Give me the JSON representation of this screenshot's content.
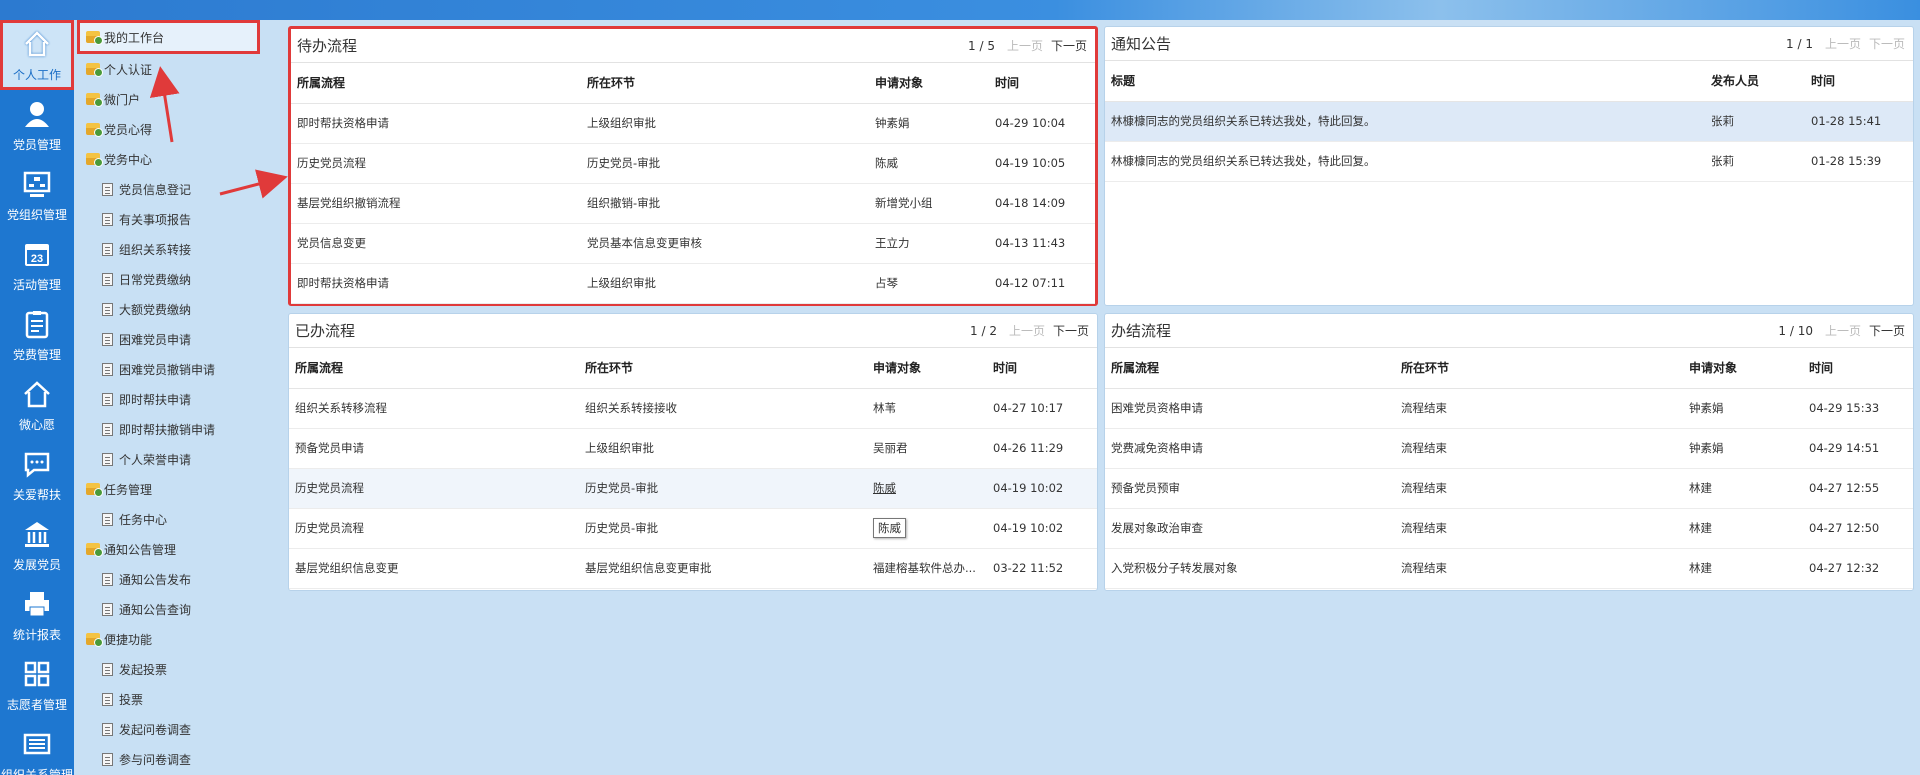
{
  "colors": {
    "accent": "#1e77d0",
    "highlight_border": "#e03a3a",
    "panel_bg": "#ffffff",
    "page_bg": "#c9e0f4"
  },
  "nav": [
    {
      "label": "个人工作",
      "icon": "home-icon"
    },
    {
      "label": "党员管理",
      "icon": "user-icon"
    },
    {
      "label": "党组织管理",
      "icon": "org-chart-icon"
    },
    {
      "label": "活动管理",
      "icon": "calendar-icon"
    },
    {
      "label": "党费管理",
      "icon": "clipboard-icon"
    },
    {
      "label": "微心愿",
      "icon": "home-outline-icon"
    },
    {
      "label": "关爱帮扶",
      "icon": "chat-icon"
    },
    {
      "label": "发展党员",
      "icon": "bank-icon"
    },
    {
      "label": "统计报表",
      "icon": "printer-icon"
    },
    {
      "label": "志愿者管理",
      "icon": "grid-icon"
    },
    {
      "label": "组织关系管理",
      "icon": "list-icon"
    }
  ],
  "menu": [
    {
      "label": "我的工作台",
      "type": "folder"
    },
    {
      "label": "个人认证",
      "type": "folder"
    },
    {
      "label": "微门户",
      "type": "folder"
    },
    {
      "label": "党员心得",
      "type": "folder"
    },
    {
      "label": "党务中心",
      "type": "folder"
    },
    {
      "label": "党员信息登记",
      "type": "doc"
    },
    {
      "label": "有关事项报告",
      "type": "doc"
    },
    {
      "label": "组织关系转接",
      "type": "doc"
    },
    {
      "label": "日常党费缴纳",
      "type": "doc"
    },
    {
      "label": "大额党费缴纳",
      "type": "doc"
    },
    {
      "label": "困难党员申请",
      "type": "doc"
    },
    {
      "label": "困难党员撤销申请",
      "type": "doc"
    },
    {
      "label": "即时帮扶申请",
      "type": "doc"
    },
    {
      "label": "即时帮扶撤销申请",
      "type": "doc"
    },
    {
      "label": "个人荣誉申请",
      "type": "doc"
    },
    {
      "label": "任务管理",
      "type": "folder"
    },
    {
      "label": "任务中心",
      "type": "doc"
    },
    {
      "label": "通知公告管理",
      "type": "folder"
    },
    {
      "label": "通知公告发布",
      "type": "doc"
    },
    {
      "label": "通知公告查询",
      "type": "doc"
    },
    {
      "label": "便捷功能",
      "type": "folder"
    },
    {
      "label": "发起投票",
      "type": "doc"
    },
    {
      "label": "投票",
      "type": "doc"
    },
    {
      "label": "发起问卷调查",
      "type": "doc"
    },
    {
      "label": "参与问卷调查",
      "type": "doc"
    }
  ],
  "pager": {
    "prev": "上一页",
    "next": "下一页"
  },
  "pending": {
    "title": "待办流程",
    "page": "1 / 5",
    "columns": [
      "所属流程",
      "所在环节",
      "申请对象",
      "时间"
    ],
    "rows": [
      [
        "即时帮扶资格申请",
        "上级组织审批",
        "钟素娟",
        "04-29 10:04"
      ],
      [
        "历史党员流程",
        "历史党员-审批",
        "陈威",
        "04-19 10:05"
      ],
      [
        "基层党组织撤销流程",
        "组织撤销-审批",
        "新增党小组",
        "04-18 14:09"
      ],
      [
        "党员信息变更",
        "党员基本信息变更审核",
        "王立力",
        "04-13 11:43"
      ],
      [
        "即时帮扶资格申请",
        "上级组织审批",
        "占琴",
        "04-12 07:11"
      ]
    ]
  },
  "notice": {
    "title": "通知公告",
    "page": "1 / 1",
    "columns": [
      "标题",
      "发布人员",
      "时间"
    ],
    "rows": [
      [
        "林槺槺同志的党员组织关系已转达我处，特此回复。",
        "张莉",
        "01-28 15:41"
      ],
      [
        "林槺槺同志的党员组织关系已转达我处，特此回复。",
        "张莉",
        "01-28 15:39"
      ]
    ]
  },
  "done": {
    "title": "已办流程",
    "page": "1 / 2",
    "columns": [
      "所属流程",
      "所在环节",
      "申请对象",
      "时间"
    ],
    "rows": [
      [
        "组织关系转移流程",
        "组织关系转接接收",
        "林苇",
        "04-27 10:17"
      ],
      [
        "预备党员申请",
        "上级组织审批",
        "吴丽君",
        "04-26 11:29"
      ],
      [
        "历史党员流程",
        "历史党员-审批",
        "陈威",
        "04-19 10:02"
      ],
      [
        "历史党员流程",
        "历史党员-审批",
        "陈威",
        "04-19 10:02"
      ],
      [
        "基层党组织信息变更",
        "基层党组织信息变更审批",
        "福建榕基软件总办...",
        "03-22 11:52"
      ]
    ]
  },
  "finished": {
    "title": "办结流程",
    "page": "1 / 10",
    "columns": [
      "所属流程",
      "所在环节",
      "申请对象",
      "时间"
    ],
    "rows": [
      [
        "困难党员资格申请",
        "流程结束",
        "钟素娟",
        "04-29 15:33"
      ],
      [
        "党费减免资格申请",
        "流程结束",
        "钟素娟",
        "04-29 14:51"
      ],
      [
        "预备党员预审",
        "流程结束",
        "林建",
        "04-27 12:55"
      ],
      [
        "发展对象政治审查",
        "流程结束",
        "林建",
        "04-27 12:50"
      ],
      [
        "入党积极分子转发展对象",
        "流程结束",
        "林建",
        "04-27 12:32"
      ]
    ]
  }
}
